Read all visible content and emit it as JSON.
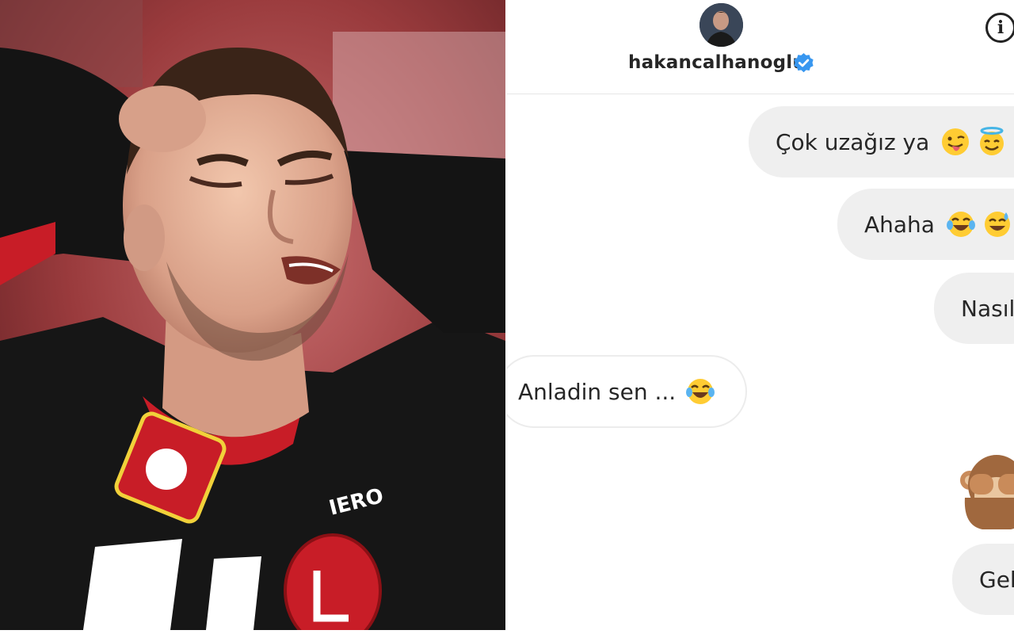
{
  "chat": {
    "username": "hakancalhanoglu",
    "messages": [
      {
        "direction": "outgoing",
        "text": "Çok uzağız ya",
        "emojis": [
          "tongue-out-emoji",
          "halo-smile-emoji"
        ]
      },
      {
        "direction": "outgoing",
        "text": "Ahaha",
        "emojis": [
          "tears-of-joy-emoji",
          "sweat-smile-emoji"
        ]
      },
      {
        "direction": "outgoing",
        "text": "Nasıl"
      },
      {
        "direction": "incoming",
        "text": "Anladin sen ...",
        "emojis": [
          "tears-of-joy-emoji"
        ]
      },
      {
        "direction": "outgoing",
        "emoji_only": "see-no-evil-monkey-emoji"
      },
      {
        "direction": "outgoing",
        "text": "Gel"
      }
    ]
  },
  "icons": {
    "info": "info-icon",
    "verified": "verified-badge-icon"
  },
  "colors": {
    "verified_blue": "#3897f0",
    "outgoing_bubble": "#efefef",
    "jersey_red": "#d61f26"
  }
}
